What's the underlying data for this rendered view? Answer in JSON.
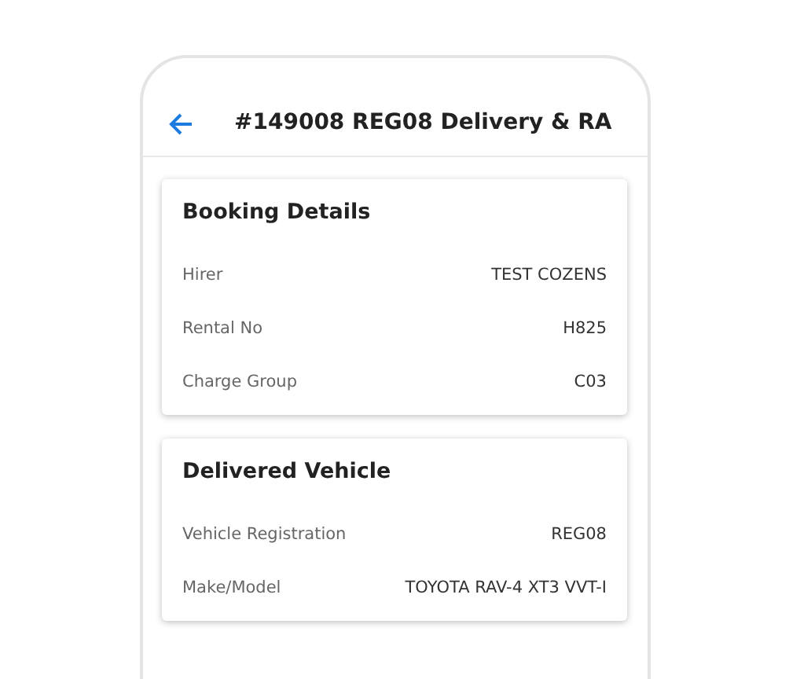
{
  "header": {
    "title": "#149008 REG08 Delivery & RA"
  },
  "cards": [
    {
      "title": "Booking Details",
      "rows": [
        {
          "label": "Hirer",
          "value": "TEST COZENS"
        },
        {
          "label": "Rental No",
          "value": "H825"
        },
        {
          "label": "Charge Group",
          "value": "C03"
        }
      ]
    },
    {
      "title": "Delivered Vehicle",
      "rows": [
        {
          "label": "Vehicle Registration",
          "value": "REG08"
        },
        {
          "label": "Make/Model",
          "value": "TOYOTA RAV-4 XT3 VVT-I"
        }
      ]
    }
  ]
}
